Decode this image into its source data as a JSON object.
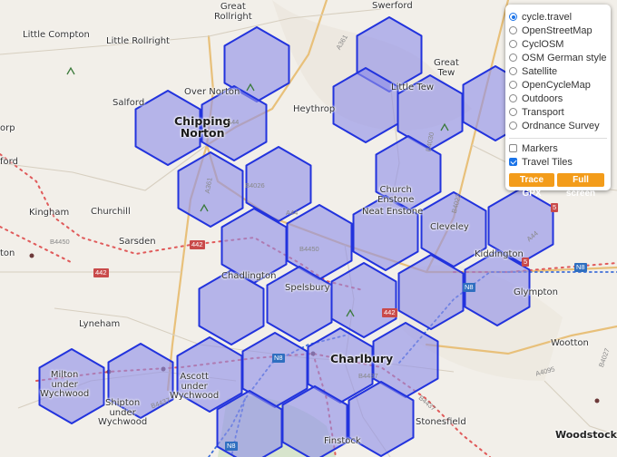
{
  "colors": {
    "tile_fill": "#8f8fe8",
    "tile_stroke": "#2233dd",
    "rail": "#e05a5a",
    "route": "#3f6fd8",
    "accent_button": "#f39c1a"
  },
  "layers": {
    "base": [
      {
        "label": "cycle.travel",
        "selected": true
      },
      {
        "label": "OpenStreetMap",
        "selected": false
      },
      {
        "label": "CyclOSM",
        "selected": false
      },
      {
        "label": "OSM German style",
        "selected": false
      },
      {
        "label": "Satellite",
        "selected": false
      },
      {
        "label": "OpenCycleMap",
        "selected": false
      },
      {
        "label": "Outdoors",
        "selected": false
      },
      {
        "label": "Transport",
        "selected": false
      },
      {
        "label": "Ordnance Survey",
        "selected": false
      }
    ],
    "overlays": [
      {
        "label": "Markers",
        "checked": false
      },
      {
        "label": "Travel Tiles",
        "checked": true
      }
    ],
    "buttons": {
      "trace": "Trace GPX",
      "fullscreen": "Full screen"
    }
  },
  "places": [
    {
      "id": "great-rollright",
      "text": "Great\nRollright"
    },
    {
      "id": "swerford",
      "text": "Swerford"
    },
    {
      "id": "little-compton",
      "text": "Little Compton"
    },
    {
      "id": "little-rollright",
      "text": "Little Rollright"
    },
    {
      "id": "great-tew",
      "text": "Great\nTew"
    },
    {
      "id": "over-norton",
      "text": "Over Norton"
    },
    {
      "id": "little-tew",
      "text": "Little Tew"
    },
    {
      "id": "salford",
      "text": "Salford"
    },
    {
      "id": "chipping-norton",
      "text": "Chipping\nNorton"
    },
    {
      "id": "heythrop",
      "text": "Heythrop"
    },
    {
      "id": "church-enstone",
      "text": "Church\nEnstone"
    },
    {
      "id": "kingham",
      "text": "Kingham"
    },
    {
      "id": "churchill",
      "text": "Churchill"
    },
    {
      "id": "neat-enstone",
      "text": "Neat Enstone"
    },
    {
      "id": "cleveley",
      "text": "Cleveley"
    },
    {
      "id": "sarsden",
      "text": "Sarsden"
    },
    {
      "id": "kiddington",
      "text": "Kiddington"
    },
    {
      "id": "chadlington",
      "text": "Chadlington"
    },
    {
      "id": "spelsbury",
      "text": "Spelsbury"
    },
    {
      "id": "glympton",
      "text": "Glympton"
    },
    {
      "id": "lyneham",
      "text": "Lyneham"
    },
    {
      "id": "charlbury",
      "text": "Charlbury"
    },
    {
      "id": "wootton",
      "text": "Wootton"
    },
    {
      "id": "milton",
      "text": "Milton\nunder\nWychwood"
    },
    {
      "id": "ascott",
      "text": "Ascott\nunder\nWychwood"
    },
    {
      "id": "shipton",
      "text": "Shipton\nunder\nWychwood"
    },
    {
      "id": "stonesfield",
      "text": "Stonesfield"
    },
    {
      "id": "finstock",
      "text": "Finstock"
    },
    {
      "id": "woodstock",
      "text": "Woodstock"
    },
    {
      "id": "ford",
      "text": "ford"
    },
    {
      "id": "orp",
      "text": "orp"
    },
    {
      "id": "ton",
      "text": "ton"
    }
  ],
  "road_badges": [
    "442",
    "442",
    "442",
    "5",
    "5",
    "N8",
    "N8",
    "N8",
    "N8"
  ],
  "road_numbers": [
    "A361",
    "A44",
    "A44",
    "B4026",
    "A361",
    "B4030",
    "B4022",
    "B4437",
    "B4437",
    "B4450",
    "B4450",
    "A44",
    "B4437",
    "B4027",
    "A4095"
  ]
}
